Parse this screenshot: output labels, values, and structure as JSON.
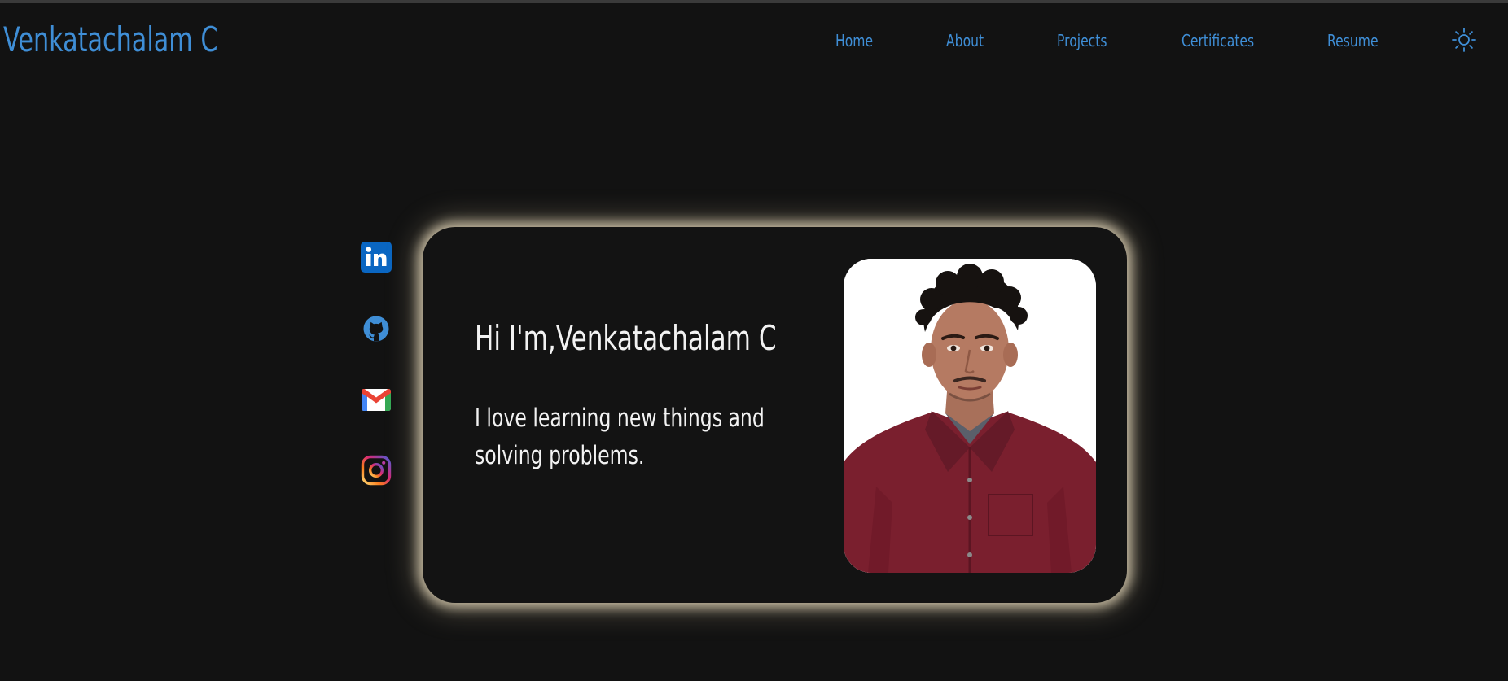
{
  "header": {
    "brand": "Venkatachalam C",
    "nav": [
      {
        "label": "Home"
      },
      {
        "label": "About"
      },
      {
        "label": "Projects"
      },
      {
        "label": "Certificates"
      },
      {
        "label": "Resume"
      }
    ],
    "theme_toggle_icon": "sun-icon"
  },
  "socials": [
    {
      "icon": "linkedin-icon",
      "color": "#0a66c2"
    },
    {
      "icon": "github-icon",
      "color": "#3f8ed6"
    },
    {
      "icon": "gmail-icon",
      "color": "#ea4335"
    },
    {
      "icon": "instagram-icon",
      "color": "#d62976"
    }
  ],
  "hero": {
    "greeting": "Hi I'm,Venkatachalam C",
    "tagline": "I love learning new things and solving problems.",
    "photo_icon": "profile-photo"
  },
  "colors": {
    "background": "#121212",
    "accent": "#3f8ed6",
    "text": "#f2f2f2",
    "glow": "#ebdec0"
  }
}
